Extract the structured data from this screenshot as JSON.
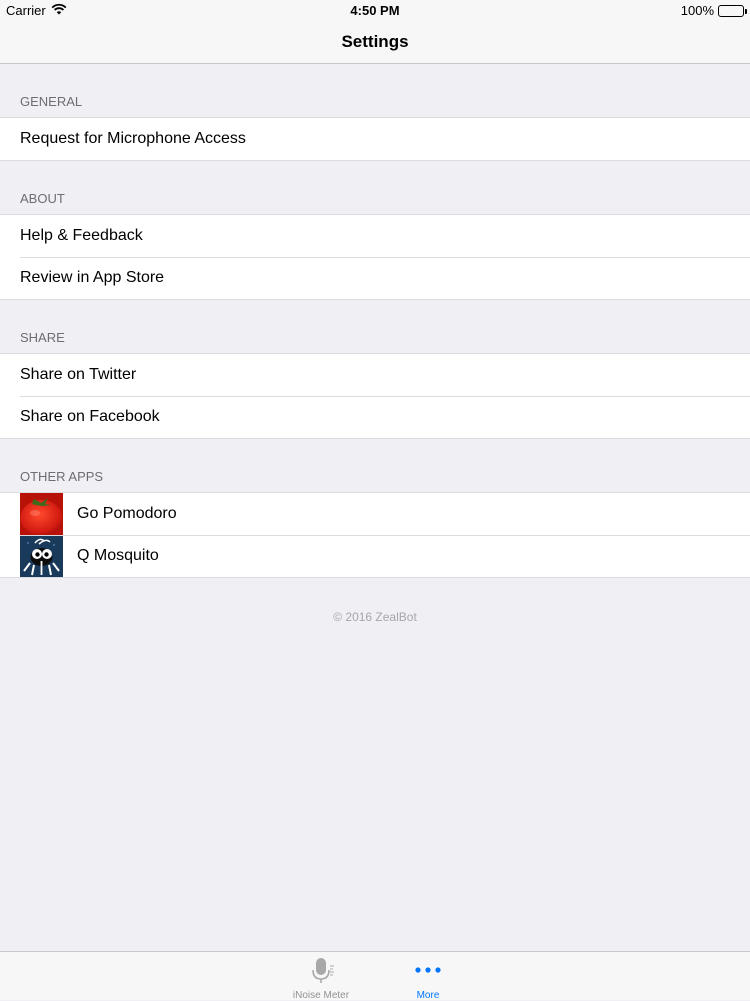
{
  "status": {
    "carrier": "Carrier",
    "time": "4:50 PM",
    "battery": "100%"
  },
  "nav": {
    "title": "Settings"
  },
  "sections": [
    {
      "header": "GENERAL",
      "rows": [
        "Request for Microphone Access"
      ]
    },
    {
      "header": "ABOUT",
      "rows": [
        "Help & Feedback",
        "Review in App Store"
      ]
    },
    {
      "header": "SHARE",
      "rows": [
        "Share on Twitter",
        "Share on Facebook"
      ]
    },
    {
      "header": "OTHER APPS",
      "apps": [
        "Go Pomodoro",
        "Q Mosquito"
      ]
    }
  ],
  "footer": "© 2016 ZealBot",
  "tabs": [
    {
      "label": "iNoise Meter",
      "icon": "microphone-icon",
      "active": false
    },
    {
      "label": "More",
      "icon": "more-icon",
      "active": true
    }
  ],
  "colors": {
    "accent": "#0076ff",
    "background": "#efeff4"
  }
}
